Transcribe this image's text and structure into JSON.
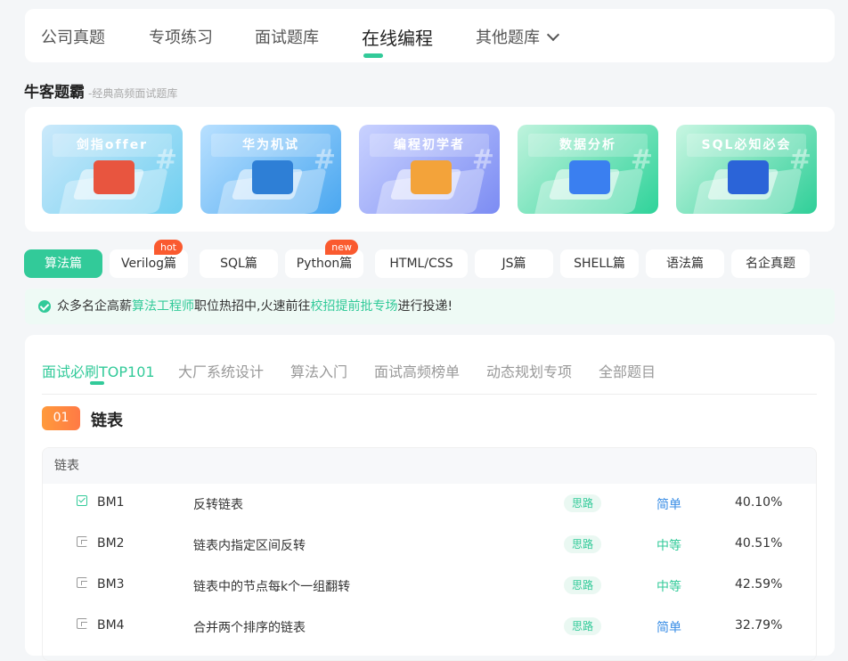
{
  "nav": {
    "items": [
      "公司真题",
      "专项练习",
      "面试题库",
      "在线编程",
      "其他题库"
    ],
    "active_index": 3
  },
  "section": {
    "title": "牛客题霸",
    "subtitle": "-经典高频面试题库"
  },
  "banners": [
    {
      "title": "剑指offer",
      "gradient": [
        "#cbe9fb",
        "#6fcff0"
      ],
      "object_color": "#e8553f"
    },
    {
      "title": "华为机试",
      "gradient": [
        "#b8e0ff",
        "#4aa7f0"
      ],
      "object_color": "#2e7fd6"
    },
    {
      "title": "编程初学者",
      "gradient": [
        "#c9d2ff",
        "#7c8cf3"
      ],
      "object_color": "#f3a33a"
    },
    {
      "title": "数据分析",
      "gradient": [
        "#bff3dd",
        "#2fd39a"
      ],
      "object_color": "#3a7ff0"
    },
    {
      "title": "SQL必知必会",
      "gradient": [
        "#c8f6e2",
        "#2fcf98"
      ],
      "object_color": "#2b64d8"
    }
  ],
  "pills": [
    {
      "label": "算法篇",
      "active": true,
      "badge": ""
    },
    {
      "label": "Verilog篇",
      "active": false,
      "badge": "hot"
    },
    {
      "label": "SQL篇",
      "active": false,
      "badge": ""
    },
    {
      "label": "Python篇",
      "active": false,
      "badge": "new"
    },
    {
      "label": "HTML/CSS",
      "active": false,
      "badge": ""
    },
    {
      "label": "JS篇",
      "active": false,
      "badge": ""
    },
    {
      "label": "SHELL篇",
      "active": false,
      "badge": ""
    },
    {
      "label": "语法篇",
      "active": false,
      "badge": ""
    },
    {
      "label": "名企真题",
      "active": false,
      "badge": ""
    }
  ],
  "notice": {
    "part1": "众多名企高薪",
    "link1": "算法工程师",
    "part2": "职位热招中,火速前往",
    "link2": "校招提前批专场",
    "part3": "进行投递!"
  },
  "tabs": [
    "面试必刷TOP101",
    "大厂系统设计",
    "算法入门",
    "面试高频榜单",
    "动态规划专项",
    "全部题目"
  ],
  "active_tab": 0,
  "group": {
    "number": "01",
    "title": "链表"
  },
  "table": {
    "header": "链表",
    "rows": [
      {
        "id": "BM1",
        "title": "反转链表",
        "hint": "思路",
        "difficulty": "简单",
        "rate": "40.10%",
        "done": true
      },
      {
        "id": "BM2",
        "title": "链表内指定区间反转",
        "hint": "思路",
        "difficulty": "中等",
        "rate": "40.51%",
        "done": false
      },
      {
        "id": "BM3",
        "title": "链表中的节点每k个一组翻转",
        "hint": "思路",
        "difficulty": "中等",
        "rate": "42.59%",
        "done": false
      },
      {
        "id": "BM4",
        "title": "合并两个排序的链表",
        "hint": "思路",
        "difficulty": "简单",
        "rate": "32.79%",
        "done": false
      }
    ]
  }
}
